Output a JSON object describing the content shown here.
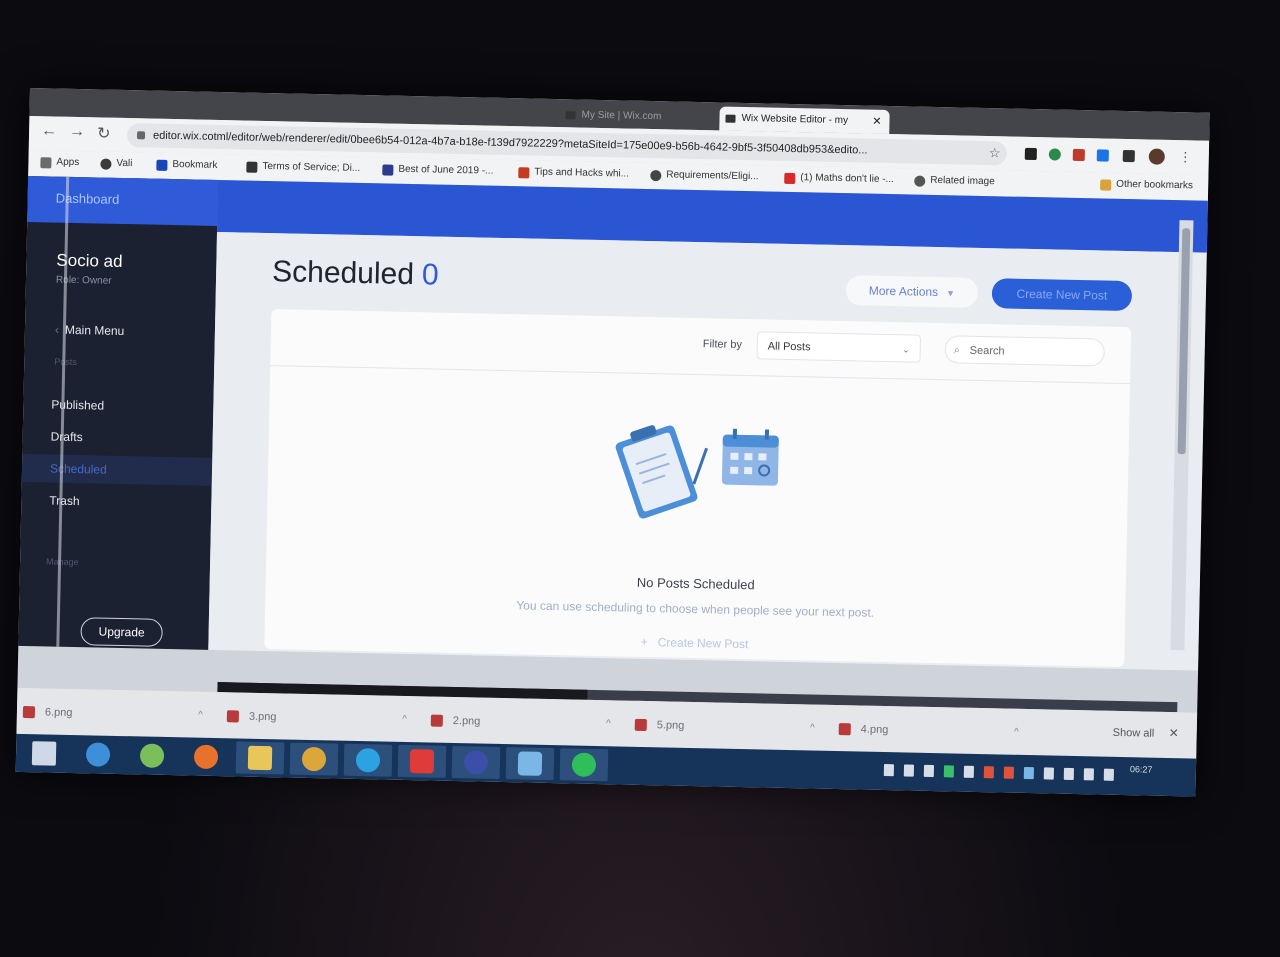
{
  "browser": {
    "tabs": [
      {
        "label": "",
        "active": false
      },
      {
        "label": "",
        "active": false
      },
      {
        "label": "",
        "active": false
      },
      {
        "label": "My Site | Wix.com",
        "active": false
      },
      {
        "label": "Wix Website Editor - my",
        "active": true
      },
      {
        "label": "",
        "active": false
      }
    ],
    "url_domain": "editor.wix.co",
    "url_path": "tml/editor/web/renderer/edit/0bee6b54-012a-4b7a-b18e-f139d7922229?metaSiteId=175e00e9-b56b-4642-9bf5-3f50408db953&edito..."
  },
  "bookmarks": [
    {
      "label": "Apps",
      "color": "#6b6b6b"
    },
    {
      "label": "Vali",
      "color": "#3c3c3c"
    },
    {
      "label": "Bookmark",
      "color": "#1a47b8"
    },
    {
      "label": "Terms of Service; Di...",
      "color": "#333333"
    },
    {
      "label": "Best of June 2019 -...",
      "color": "#2d3b8f"
    },
    {
      "label": "Tips and Hacks whi...",
      "color": "#c23b22"
    },
    {
      "label": "Requirements/Eligi...",
      "color": "#444444"
    },
    {
      "label": "(1) Maths don't lie -...",
      "color": "#d62b2b"
    },
    {
      "label": "Related image",
      "color": "#555555"
    }
  ],
  "other_bookmarks": "Other bookmarks",
  "sidebar": {
    "header": "Dashboard",
    "site_name": "Socio ad",
    "role": "Role: Owner",
    "main_menu": "Main Menu",
    "section_label": "Posts",
    "items": [
      {
        "label": "Published",
        "active": false
      },
      {
        "label": "Drafts",
        "active": false
      },
      {
        "label": "Scheduled",
        "active": true
      },
      {
        "label": "Trash",
        "active": false
      }
    ],
    "manage_label": "Manage",
    "upgrade": "Upgrade"
  },
  "main": {
    "title": "Scheduled",
    "count": "0",
    "more_actions": "More Actions",
    "create_new_post": "Create New Post",
    "filter_label": "Filter by",
    "filter_value": "All Posts",
    "search_placeholder": "Search",
    "empty_title": "No Posts Scheduled",
    "empty_subtitle": "You can use scheduling to choose when people see your next post.",
    "empty_create_link": "Create New Post"
  },
  "downloads": {
    "items": [
      "6.png",
      "3.png",
      "2.png",
      "5.png",
      "4.png"
    ],
    "show_all": "Show all"
  },
  "taskbar": {
    "apps": [
      {
        "icon": "windows-start-icon",
        "color": "#cfd8e6"
      },
      {
        "icon": "internet-explorer-icon",
        "color": "#3c8fd8"
      },
      {
        "icon": "android-studio-icon",
        "color": "#7bbf5a"
      },
      {
        "icon": "firefox-icon",
        "color": "#e8722c"
      },
      {
        "icon": "file-explorer-icon",
        "color": "#e8c65a"
      },
      {
        "icon": "chrome-icon",
        "color": "#dba73b"
      },
      {
        "icon": "edge-icon",
        "color": "#2ba3e0"
      },
      {
        "icon": "anydesk-icon",
        "color": "#e03b3b"
      },
      {
        "icon": "app-icon",
        "color": "#3b4fa8"
      },
      {
        "icon": "app-icon",
        "color": "#7ab6e6"
      },
      {
        "icon": "whatsapp-icon",
        "color": "#2fbf5a"
      }
    ],
    "time": "06:27"
  }
}
